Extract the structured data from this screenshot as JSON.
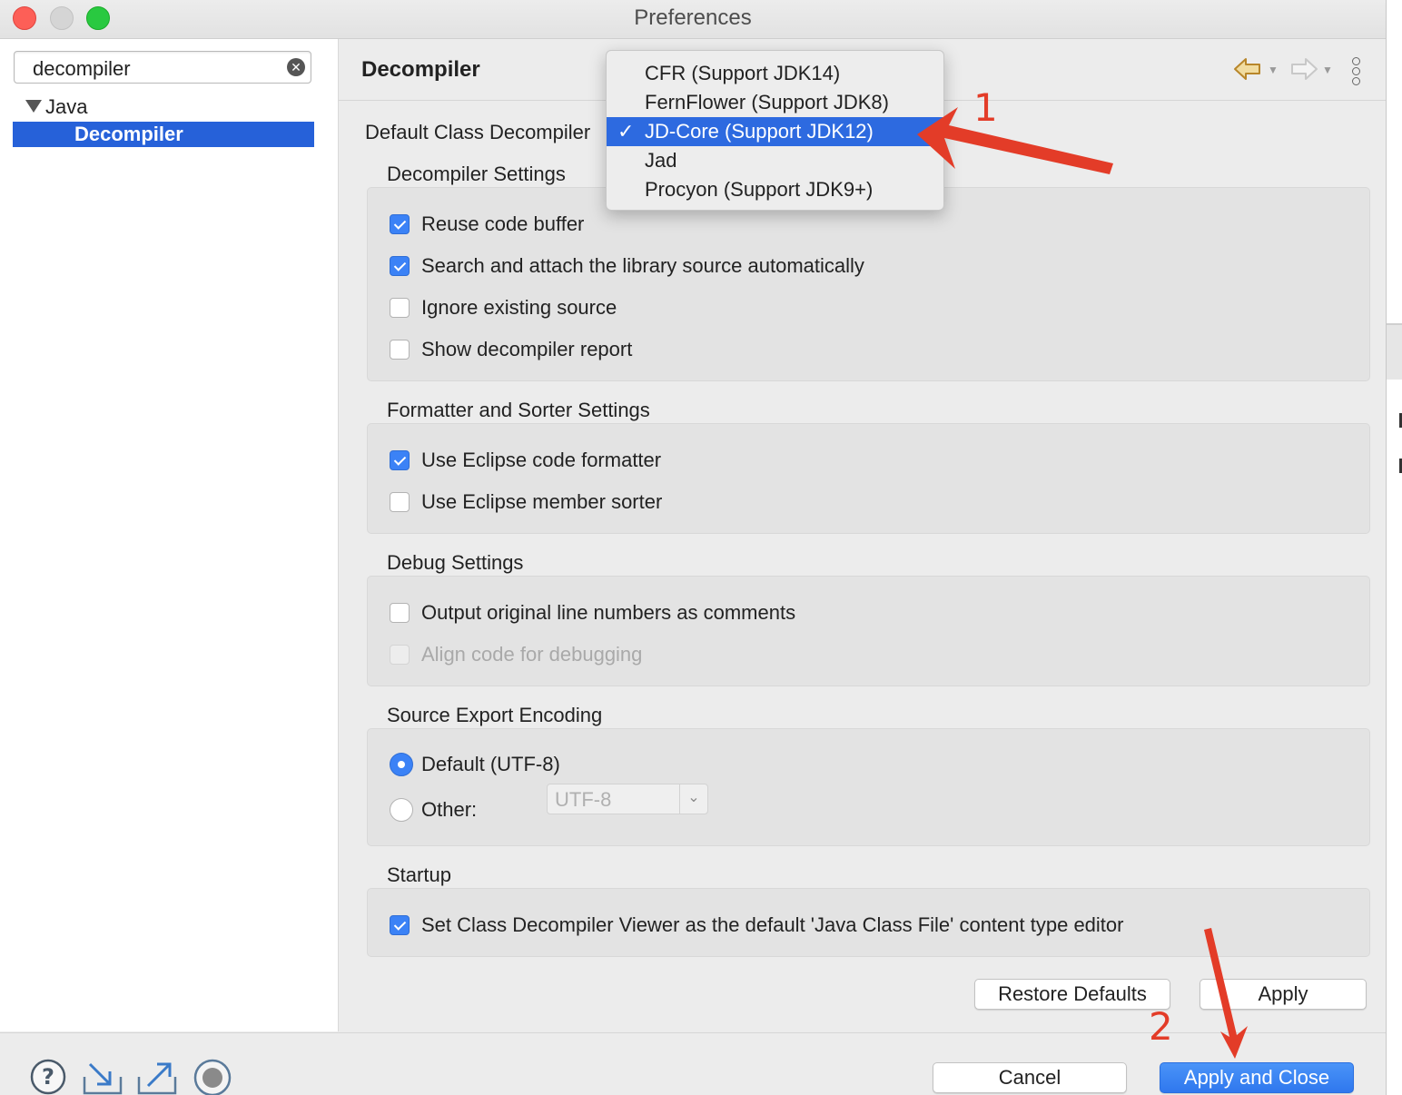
{
  "window": {
    "title": "Preferences"
  },
  "sidebar": {
    "search_value": "decompiler",
    "tree": {
      "parent": "Java",
      "selected": "Decompiler"
    }
  },
  "page": {
    "title": "Decompiler",
    "default_decompiler_label": "Default Class Decompiler",
    "decompiler_options": [
      {
        "label": "CFR (Support JDK14)",
        "selected": false
      },
      {
        "label": "FernFlower (Support JDK8)",
        "selected": false
      },
      {
        "label": "JD-Core (Support JDK12)",
        "selected": true
      },
      {
        "label": "Jad",
        "selected": false
      },
      {
        "label": "Procyon (Support JDK9+)",
        "selected": false
      }
    ],
    "checkmark": "✓"
  },
  "groups": {
    "decompiler_settings": {
      "title": "Decompiler Settings",
      "items": [
        {
          "label": "Reuse code buffer",
          "checked": true
        },
        {
          "label": "Search and attach the library source automatically",
          "checked": true
        },
        {
          "label": "Ignore existing source",
          "checked": false
        },
        {
          "label": "Show decompiler report",
          "checked": false
        }
      ]
    },
    "formatter": {
      "title": "Formatter and Sorter Settings",
      "items": [
        {
          "label": "Use Eclipse code formatter",
          "checked": true
        },
        {
          "label": "Use Eclipse member sorter",
          "checked": false
        }
      ]
    },
    "debug": {
      "title": "Debug Settings",
      "items": [
        {
          "label": "Output original line numbers as comments",
          "checked": false
        },
        {
          "label": "Align code for debugging",
          "checked": false,
          "disabled": true
        }
      ]
    },
    "encoding": {
      "title": "Source Export Encoding",
      "default_label": "Default (UTF-8)",
      "other_label": "Other:",
      "other_value": "UTF-8",
      "selected": "default"
    },
    "startup": {
      "title": "Startup",
      "items": [
        {
          "label": "Set Class Decompiler Viewer as the default 'Java Class File' content type editor",
          "checked": true
        }
      ]
    }
  },
  "buttons": {
    "restore_defaults": "Restore Defaults",
    "apply": "Apply",
    "cancel": "Cancel",
    "apply_and_close": "Apply and Close"
  },
  "annotations": {
    "step1": "1",
    "step2": "2",
    "color": "#e33c28"
  },
  "colors": {
    "accent": "#2661d9",
    "selection": "#2d6ae0",
    "checkbox": "#3b82f6"
  },
  "icons": [
    "help-icon",
    "import-icon",
    "export-icon",
    "record-icon",
    "back-arrow-icon",
    "forward-arrow-icon",
    "view-menu-icon",
    "clear-search-icon"
  ]
}
